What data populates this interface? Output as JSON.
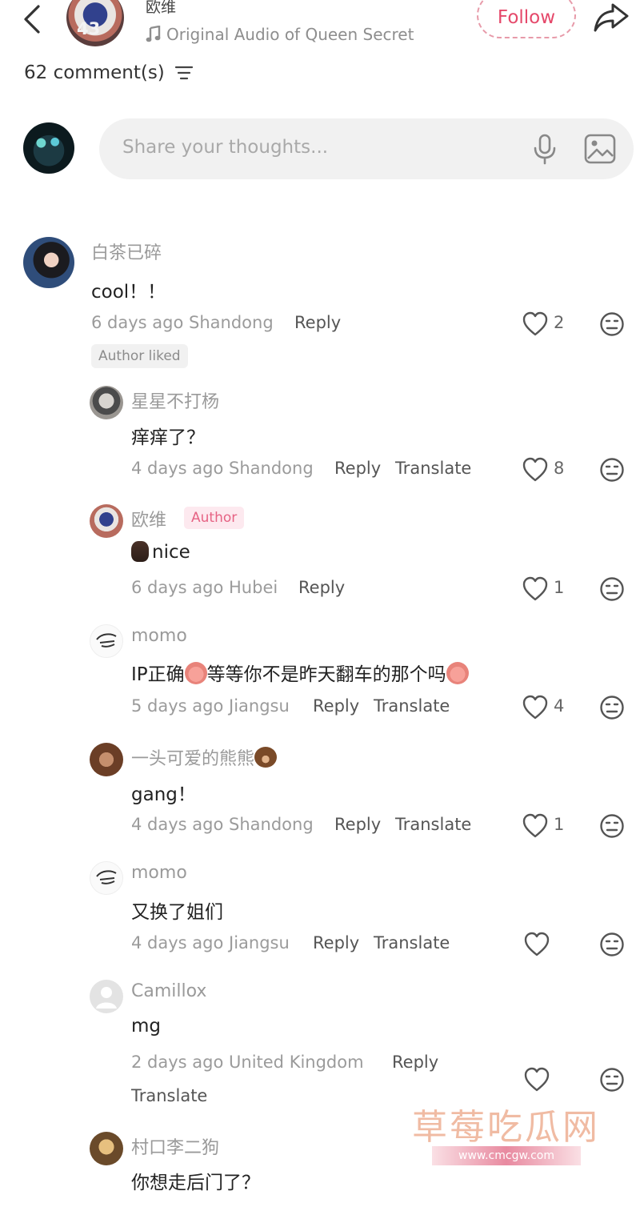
{
  "header": {
    "username": "欧维",
    "avatar_badge": "43",
    "audio": "Original Audio of Queen Secret",
    "follow_label": "Follow"
  },
  "comments_count": "62 comment(s)",
  "composer": {
    "placeholder": "Share your thoughts..."
  },
  "comments": [
    {
      "user": "白茶已碎",
      "text": "cool！！",
      "time": "6 days ago",
      "location": "Shandong",
      "reply": "Reply",
      "likes": "2",
      "badge": "Author liked"
    },
    {
      "user": "星星不打杨",
      "text": "痒痒了？",
      "time": "4 days ago",
      "location": "Shandong",
      "reply": "Reply",
      "translate": "Translate",
      "likes": "8"
    },
    {
      "user": "欧维",
      "author_badge": "Author",
      "text": "nice",
      "time": "6 days ago",
      "location": "Hubei",
      "reply": "Reply",
      "likes": "1"
    },
    {
      "user": "momo",
      "text_a": "IP正确",
      "text_b": "等等你不是昨天翻车的那个吗",
      "time": "5 days ago",
      "location": "Jiangsu",
      "reply": "Reply",
      "translate": "Translate",
      "likes": "4"
    },
    {
      "user": "一头可爱的熊熊",
      "text": "gang！",
      "time": "4 days ago",
      "location": "Shandong",
      "reply": "Reply",
      "translate": "Translate",
      "likes": "1"
    },
    {
      "user": "momo",
      "text": "又换了姐们",
      "time": "4 days ago",
      "location": "Jiangsu",
      "reply": "Reply",
      "translate": "Translate",
      "likes": ""
    },
    {
      "user": "Camillox",
      "text": "mg",
      "time": "2 days ago",
      "location": "United Kingdom",
      "reply": "Reply",
      "translate": "Translate",
      "likes": ""
    },
    {
      "user": "村口李二狗",
      "text": "你想走后门了？"
    }
  ],
  "watermark": {
    "text": "草莓吃瓜网",
    "url": "www.cmcgw.com"
  },
  "colors": {
    "accent": "#e5486a",
    "muted": "#9b9b9b",
    "composer_bg": "#f1f1f1"
  }
}
